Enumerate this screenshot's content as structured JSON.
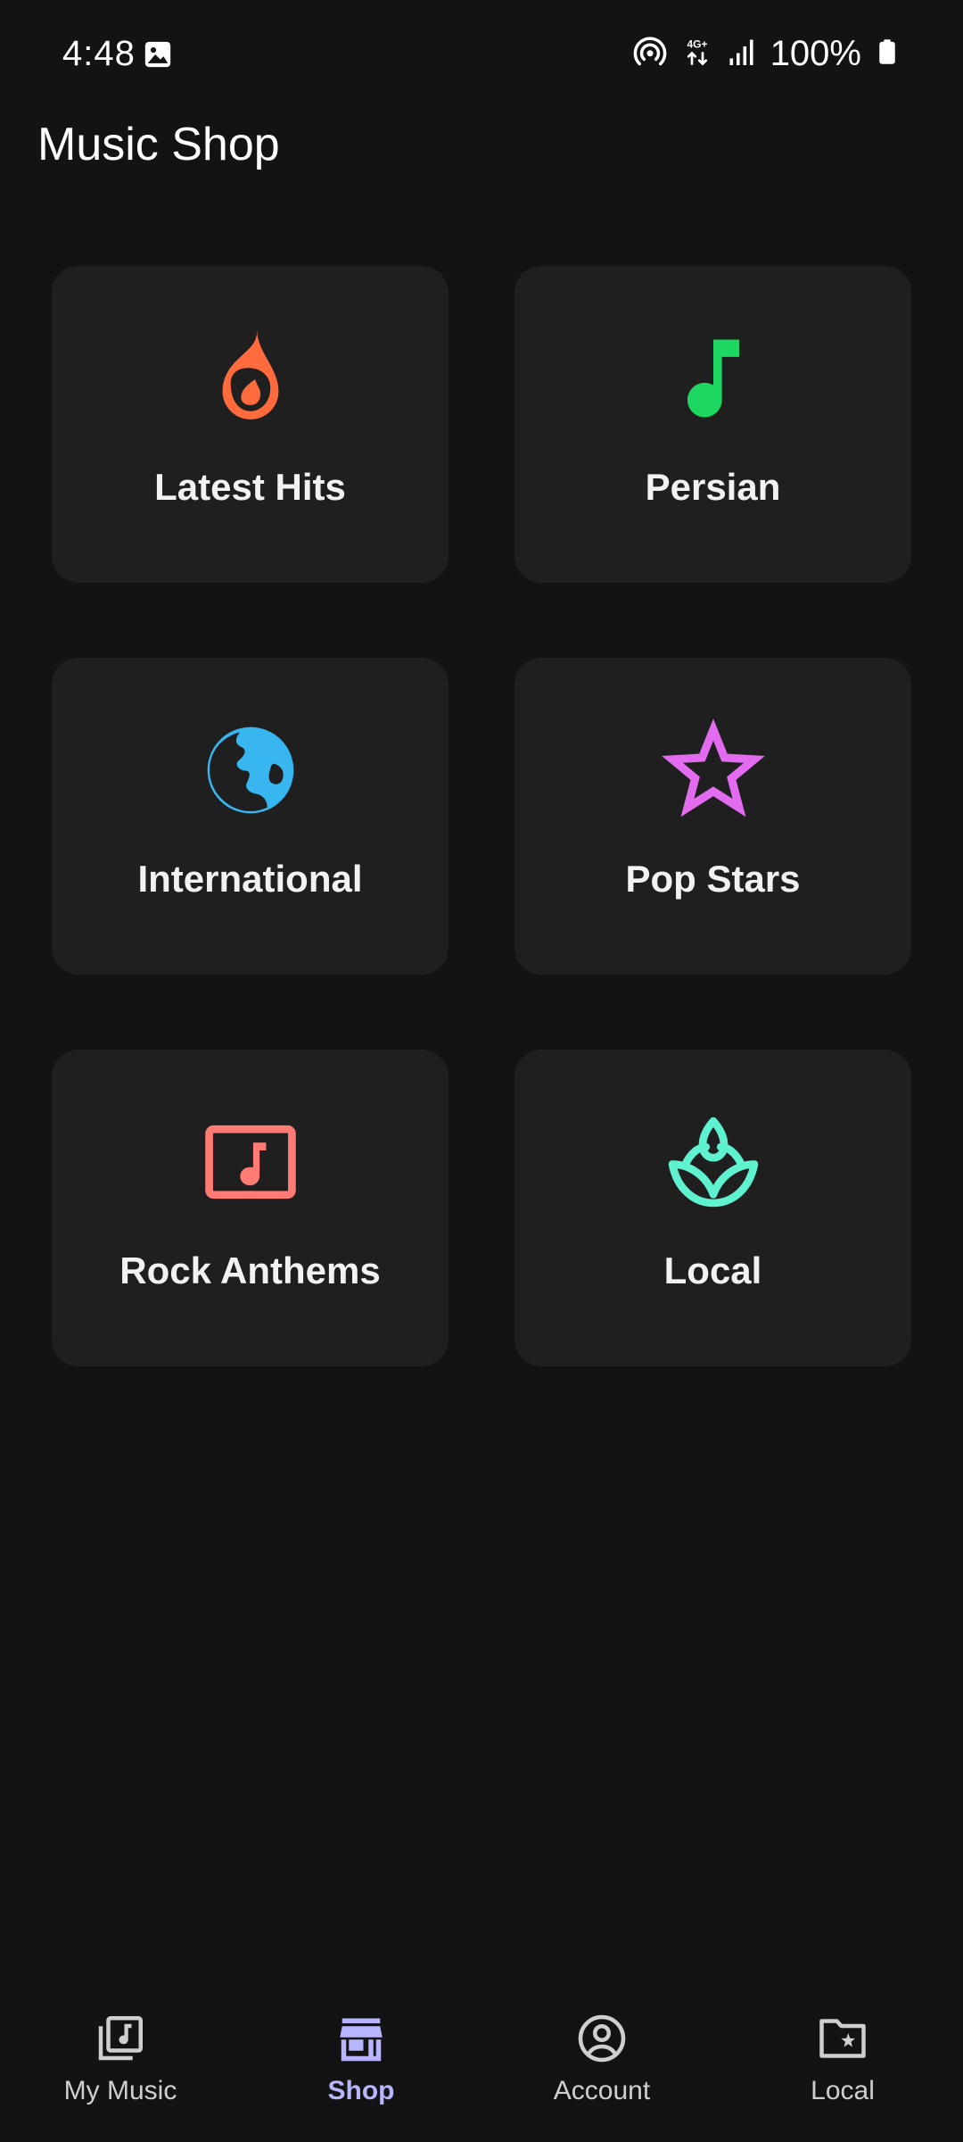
{
  "status_bar": {
    "time": "4:48",
    "battery": "100%",
    "network_label": "4G+",
    "icons": [
      "gallery-icon",
      "hotspot-icon",
      "mobile-data-icon",
      "signal-icon",
      "battery-icon"
    ]
  },
  "app": {
    "title": "Music Shop"
  },
  "categories": [
    {
      "label": "Latest Hits",
      "icon": "flame-icon",
      "color": "#FF6B3D"
    },
    {
      "label": "Persian",
      "icon": "music-note-icon",
      "color": "#1ED760"
    },
    {
      "label": "International",
      "icon": "globe-icon",
      "color": "#38B6F0"
    },
    {
      "label": "Pop Stars",
      "icon": "star-icon",
      "color": "#E36BF0"
    },
    {
      "label": "Rock Anthems",
      "icon": "music-video-icon",
      "color": "#FF7B74"
    },
    {
      "label": "Local",
      "icon": "spa-icon",
      "color": "#5EF2D0"
    }
  ],
  "bottom_nav": {
    "active": "Shop",
    "active_color": "#B8B5FF",
    "inactive_color": "#CFCFCF",
    "items": [
      {
        "label": "My Music",
        "icon": "library-music-icon"
      },
      {
        "label": "Shop",
        "icon": "store-icon"
      },
      {
        "label": "Account",
        "icon": "account-circle-icon"
      },
      {
        "label": "Local",
        "icon": "folder-star-icon"
      }
    ]
  }
}
